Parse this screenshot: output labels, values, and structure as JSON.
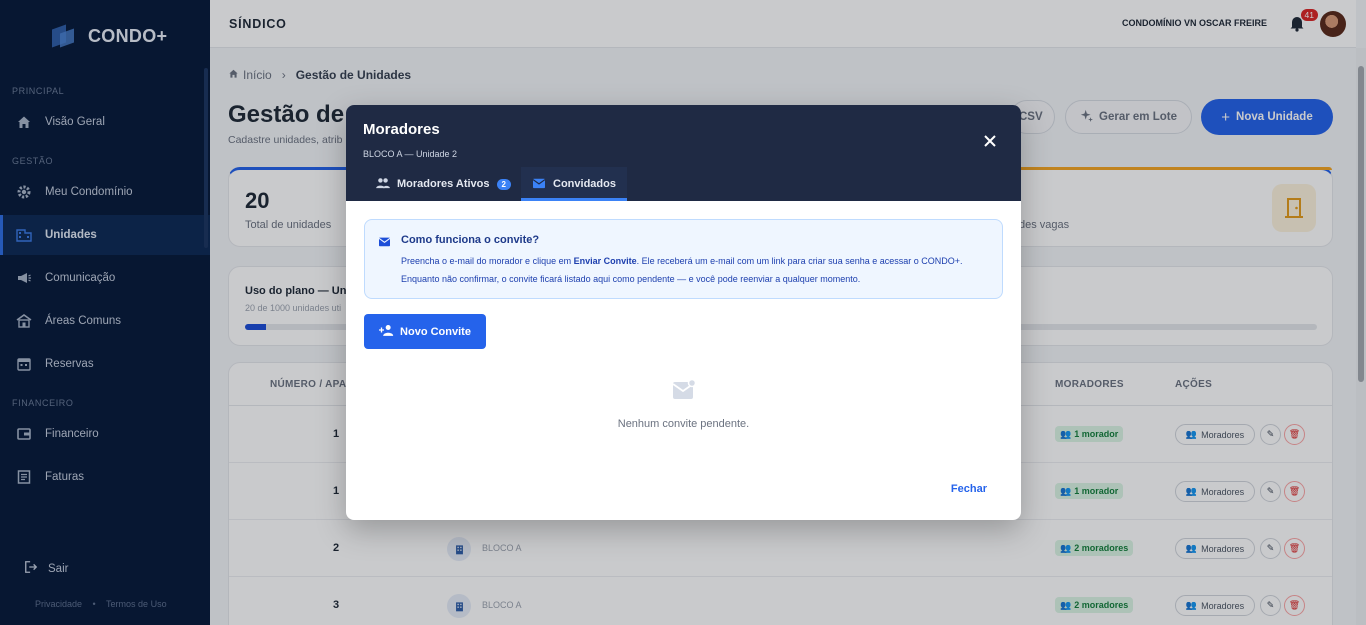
{
  "sidebar": {
    "brand": "CONDO+",
    "sections": {
      "principal": "PRINCIPAL",
      "gestao": "GESTÃO",
      "financeiro": "FINANCEIRO"
    },
    "items": {
      "visao_geral": "Visão Geral",
      "meu_condominio": "Meu Condomínio",
      "unidades": "Unidades",
      "comunicacao": "Comunicação",
      "areas_comuns": "Áreas Comuns",
      "reservas": "Reservas",
      "financeiro": "Financeiro",
      "faturas": "Faturas"
    },
    "logout": "Sair",
    "footer": {
      "privacy": "Privacidade",
      "terms": "Termos de Uso"
    }
  },
  "topbar": {
    "title": "SÍNDICO",
    "condo_name": "CONDOMÍNIO VN OSCAR FREIRE",
    "notifications": "41"
  },
  "main": {
    "breadcrumb": {
      "home": "Início",
      "current": "Gestão de Unidades"
    },
    "title": "Gestão de",
    "subtitle": "Cadastre unidades, atrib",
    "buttons": {
      "csv": "CSV",
      "lote": "Gerar em Lote",
      "nova": "Nova Unidade"
    },
    "stats": {
      "total_value": "20",
      "total_label": "Total de unidades",
      "vagas_label": "des vagas"
    },
    "plan": {
      "title": "Uso do plano — Unid",
      "subtitle": "20 de 1000 unidades uti",
      "progress": 0.02
    },
    "table": {
      "headers": {
        "numero": "NÚMERO / APA",
        "moradores": "MORADORES",
        "acoes": "AÇÕES"
      },
      "rows": [
        {
          "num": "1",
          "bloco": "",
          "moradores": "1 morador"
        },
        {
          "num": "1",
          "bloco": "",
          "moradores": "1 morador"
        },
        {
          "num": "2",
          "bloco": "BLOCO A",
          "moradores": "2 moradores"
        },
        {
          "num": "3",
          "bloco": "BLOCO A",
          "moradores": "2 moradores"
        }
      ],
      "row_action_label": "Moradores"
    }
  },
  "modal": {
    "title": "Moradores",
    "subtitle": "BLOCO A — Unidade 2",
    "tabs": {
      "ativos": "Moradores Ativos",
      "ativos_count": "2",
      "convidados": "Convidados"
    },
    "info": {
      "title": "Como funciona o convite?",
      "text_1": "Preencha o e-mail do morador e clique em ",
      "text_bold": "Enviar Convite",
      "text_2": ". Ele receberá um e-mail com um link para criar sua senha e acessar o CONDO+. Enquanto não confirmar, o convite ficará listado aqui como pendente — e você pode reenviar a qualquer momento."
    },
    "new_invite": "Novo Convite",
    "empty": "Nenhum convite pendente.",
    "close": "Fechar"
  },
  "colors": {
    "primary": "#2563eb",
    "sidebar": "#071a3a",
    "modal_header": "#1f2a44"
  }
}
